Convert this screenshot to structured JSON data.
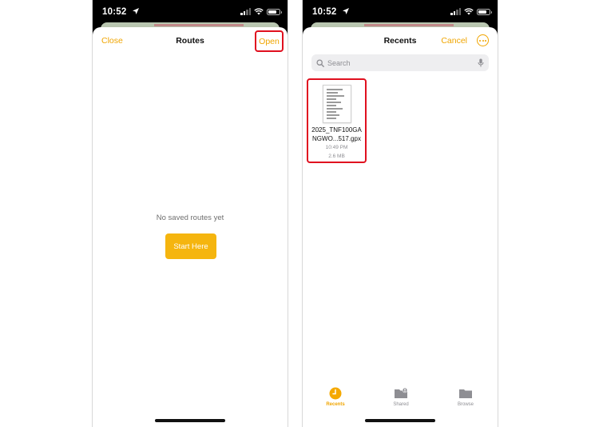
{
  "left_screen": {
    "status": {
      "time": "10:52"
    },
    "nav": {
      "close_label": "Close",
      "title": "Routes",
      "open_label": "Open"
    },
    "empty_message": "No saved routes yet",
    "start_button_label": "Start Here"
  },
  "right_screen": {
    "status": {
      "time": "10:52"
    },
    "nav": {
      "title": "Recents",
      "cancel_label": "Cancel"
    },
    "search": {
      "placeholder": "Search"
    },
    "file": {
      "name_line1": "2025_TNF100GA",
      "name_line2": "NGWO...517.gpx",
      "time": "10:49 PM",
      "size": "2.6 MB"
    },
    "tabs": [
      {
        "label": "Recents",
        "icon": "clock-icon",
        "active": true
      },
      {
        "label": "Shared",
        "icon": "shared-folder-icon",
        "active": false
      },
      {
        "label": "Browse",
        "icon": "folder-icon",
        "active": false
      }
    ]
  },
  "colors": {
    "accent": "#f0a500",
    "button": "#f5b50f",
    "highlight": "#e0101f"
  }
}
